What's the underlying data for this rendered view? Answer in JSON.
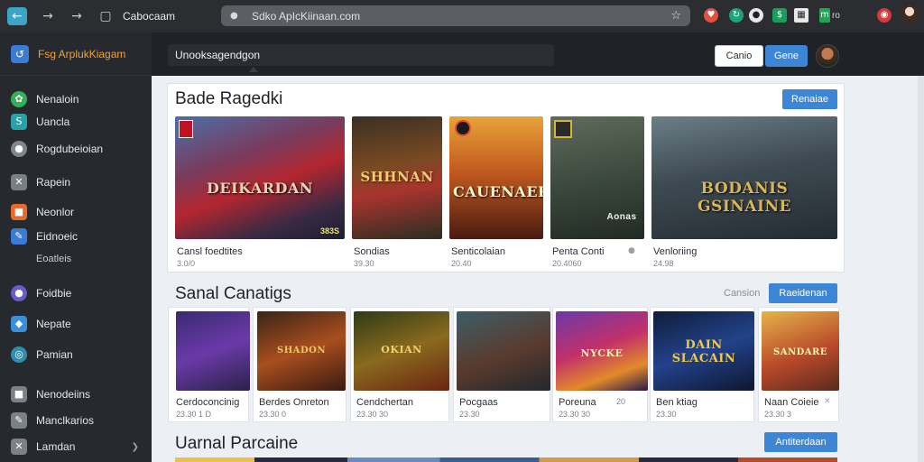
{
  "browser": {
    "tab_title": "Cabocaam",
    "url": "Sdko ApIcKiinaan.com",
    "colors": {
      "back_button": "#3ba4c7",
      "url_bar": "#5b5e63"
    },
    "extensions": [
      {
        "name": "heart-icon",
        "color": "#e0523f"
      },
      {
        "name": "circle-arrow-icon",
        "color": "#1fa37a"
      },
      {
        "name": "record-icon",
        "color": "#e8e8e8"
      },
      {
        "name": "dollar-icon",
        "color": "#1a9e5a"
      },
      {
        "name": "grid-icon",
        "color": "#e8e8e8"
      },
      {
        "name": "m-icon",
        "color": "#23a454"
      },
      {
        "name": "target-icon",
        "color": "#d63b3b"
      }
    ],
    "ext_text": "ro"
  },
  "sidebar": {
    "brand": "Fsg ArplukKiagam",
    "items": [
      {
        "label": "Nenaloin",
        "icon": "leaf-icon",
        "color": "#35b05a"
      },
      {
        "label": "Uancla",
        "icon": "s-icon",
        "color": "#2aa1a8"
      },
      {
        "label": "Rogdubeioian",
        "icon": "chat-icon",
        "color": "#7f868f"
      },
      {
        "label": "Rapein",
        "icon": "close-box-icon",
        "color": "#7a7f86"
      },
      {
        "label": "Neonlor",
        "icon": "orange-box-icon",
        "color": "#e66a2c"
      },
      {
        "label": "Eidnoeic",
        "icon": "pen-icon",
        "color": "#3a7bd5"
      },
      {
        "label": "Foidbie",
        "icon": "coin-icon",
        "color": "#6a5acd"
      },
      {
        "label": "Nepate",
        "icon": "drop-icon",
        "color": "#3b8fd9"
      },
      {
        "label": "Pamian",
        "icon": "globe-icon",
        "color": "#2f8fa8"
      },
      {
        "label": "Nenodeiins",
        "icon": "box-icon",
        "color": "#7c8088"
      },
      {
        "label": "Manclkarios",
        "icon": "key-icon",
        "color": "#7c8088"
      },
      {
        "label": "Lamdan",
        "icon": "close-square-icon",
        "color": "#7c8088"
      }
    ],
    "subitem": "Eoatleis"
  },
  "appbar": {
    "search_value": "Unooksagendgon",
    "btn_white": "Canio",
    "btn_blue": "Gene"
  },
  "sections": [
    {
      "title": "Bade Ragedki",
      "button": "Renaiae",
      "cards": [
        {
          "name": "Cansl foedtites",
          "meta": "3.0/0",
          "art_text": "DEIKARDAN",
          "badge": "383S",
          "extra": ""
        },
        {
          "name": "Sondias",
          "meta": "39.30",
          "art_text": "SHHNAN",
          "badge": "",
          "extra": ""
        },
        {
          "name": "Senticolaian",
          "meta": "20.40",
          "art_text": "CAUENAER",
          "badge": "",
          "extra": ""
        },
        {
          "name": "Penta Conti",
          "meta": "20.4060",
          "art_text": "Aonas",
          "badge": "",
          "extra": ""
        },
        {
          "name": "Venloriing",
          "meta": "24.98",
          "art_text": "BODANIS GSINAINE",
          "badge": "",
          "extra": ""
        }
      ]
    },
    {
      "title": "Sanal Canatigs",
      "link": "Cansion",
      "button": "Raeidenan",
      "cards": [
        {
          "name": "Cerdoconcinig",
          "meta": "23.30 1 D",
          "art_text": "",
          "badge": "",
          "extra": ""
        },
        {
          "name": "Berdes Onreton",
          "meta": "23.30 0",
          "art_text": "SHADON",
          "badge": "",
          "extra": ""
        },
        {
          "name": "Cendchertan",
          "meta": "23.30 30",
          "art_text": "OKIAN",
          "badge": "",
          "extra": ""
        },
        {
          "name": "Pocgaas",
          "meta": "23.30",
          "art_text": "",
          "badge": "",
          "extra": ""
        },
        {
          "name": "Poreuna",
          "meta": "23.30 30",
          "art_text": "NYCKE",
          "badge": "",
          "extra": "20"
        },
        {
          "name": "Ben ktiag",
          "meta": "23.30",
          "art_text": "DAIN SLACAIN",
          "badge": "",
          "extra": ""
        },
        {
          "name": "Naan Coieie",
          "meta": "23.30 3",
          "art_text": "SANDARE",
          "badge": "",
          "extra": ""
        }
      ]
    },
    {
      "title": "Uarnal Parcaine",
      "button": "Antiterdaan"
    }
  ]
}
